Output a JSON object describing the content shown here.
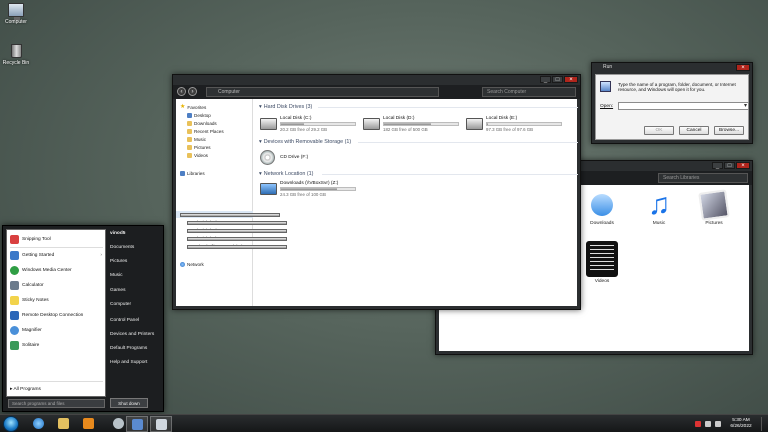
{
  "desktop": {
    "icons": [
      {
        "label": "Computer",
        "icon": "computer-icon"
      },
      {
        "label": "Recycle Bin",
        "icon": "recycle-bin-icon"
      }
    ]
  },
  "explorer": {
    "address": "Computer",
    "search_placeholder": "Search Computer",
    "sidebar": {
      "favorites": "Favorites",
      "fav_items": [
        "Desktop",
        "Downloads",
        "Recent Places",
        "Music",
        "Pictures",
        "Videos"
      ],
      "libraries": "Libraries",
      "computer": "Computer",
      "computer_items": [
        "Local Disk (C:)",
        "Local Disk (D:)",
        "Local Disk (E:)",
        "Downloads (\\\\VBoxSvr) (Z:)"
      ],
      "network": "Network"
    },
    "sections": {
      "hdd": "Hard Disk Drives (3)",
      "removable": "Devices with Removable Storage (1)",
      "network": "Network Location (1)"
    },
    "drives": [
      {
        "name": "Local Disk (C:)",
        "free": "20.2 GB free of 29.2 GB",
        "used": 0.31
      },
      {
        "name": "Local Disk (D:)",
        "free": "182 GB free of 500 GB",
        "used": 0.64
      },
      {
        "name": "Local Disk (E:)",
        "free": "97.3 GB free of 97.6 GB",
        "used": 0.01
      }
    ],
    "cd": {
      "name": "CD Drive (F:)"
    },
    "net_drive": {
      "name": "Downloads (\\\\VBoxSvr) (Z:)",
      "free": "24.3 GB free of 100 GB",
      "used": 0.76
    }
  },
  "run": {
    "title": "Run",
    "description": "Type the name of a program, folder, document, or Internet resource, and Windows will open it for you.",
    "open_label": "Open:",
    "value": "",
    "buttons": {
      "ok": "OK",
      "cancel": "Cancel",
      "browse": "Browse..."
    }
  },
  "libwin": {
    "search_placeholder": "Search Libraries",
    "items": [
      {
        "label": "Downloads",
        "icon": "downloads-icon"
      },
      {
        "label": "Music",
        "icon": "music-icon"
      },
      {
        "label": "Pictures",
        "icon": "pictures-icon"
      },
      {
        "label": "Videos",
        "icon": "videos-icon"
      }
    ]
  },
  "startmenu": {
    "programs": [
      {
        "label": "Snipping Tool",
        "icon": "snipping-tool-icon",
        "color": "#d94040",
        "arrow": false
      },
      {
        "label": "Getting Started",
        "icon": "getting-started-icon",
        "color": "#3b78c8",
        "arrow": true
      },
      {
        "label": "Windows Media Center",
        "icon": "media-center-icon",
        "color": "#2f9e44",
        "arrow": false
      },
      {
        "label": "Calculator",
        "icon": "calculator-icon",
        "color": "#6b7b8c",
        "arrow": false
      },
      {
        "label": "Sticky Notes",
        "icon": "sticky-notes-icon",
        "color": "#f2d34b",
        "arrow": false
      },
      {
        "label": "Remote Desktop Connection",
        "icon": "remote-desktop-icon",
        "color": "#2b66b8",
        "arrow": false
      },
      {
        "label": "Magnifier",
        "icon": "magnifier-icon",
        "color": "#4a90d9",
        "arrow": false
      },
      {
        "label": "Solitaire",
        "icon": "solitaire-icon",
        "color": "#3a9a5a",
        "arrow": false
      }
    ],
    "all_programs": "All Programs",
    "search_placeholder": "Search programs and files",
    "right_items": [
      "vinod5",
      "Documents",
      "Pictures",
      "Music",
      "Games",
      "Computer",
      "Control Panel",
      "Devices and Printers",
      "Default Programs",
      "Help and Support"
    ],
    "shutdown": "Shut down"
  },
  "taskbar": {
    "time": "5:30 AM",
    "date": "6/26/2022",
    "accent": "#1777c4"
  }
}
